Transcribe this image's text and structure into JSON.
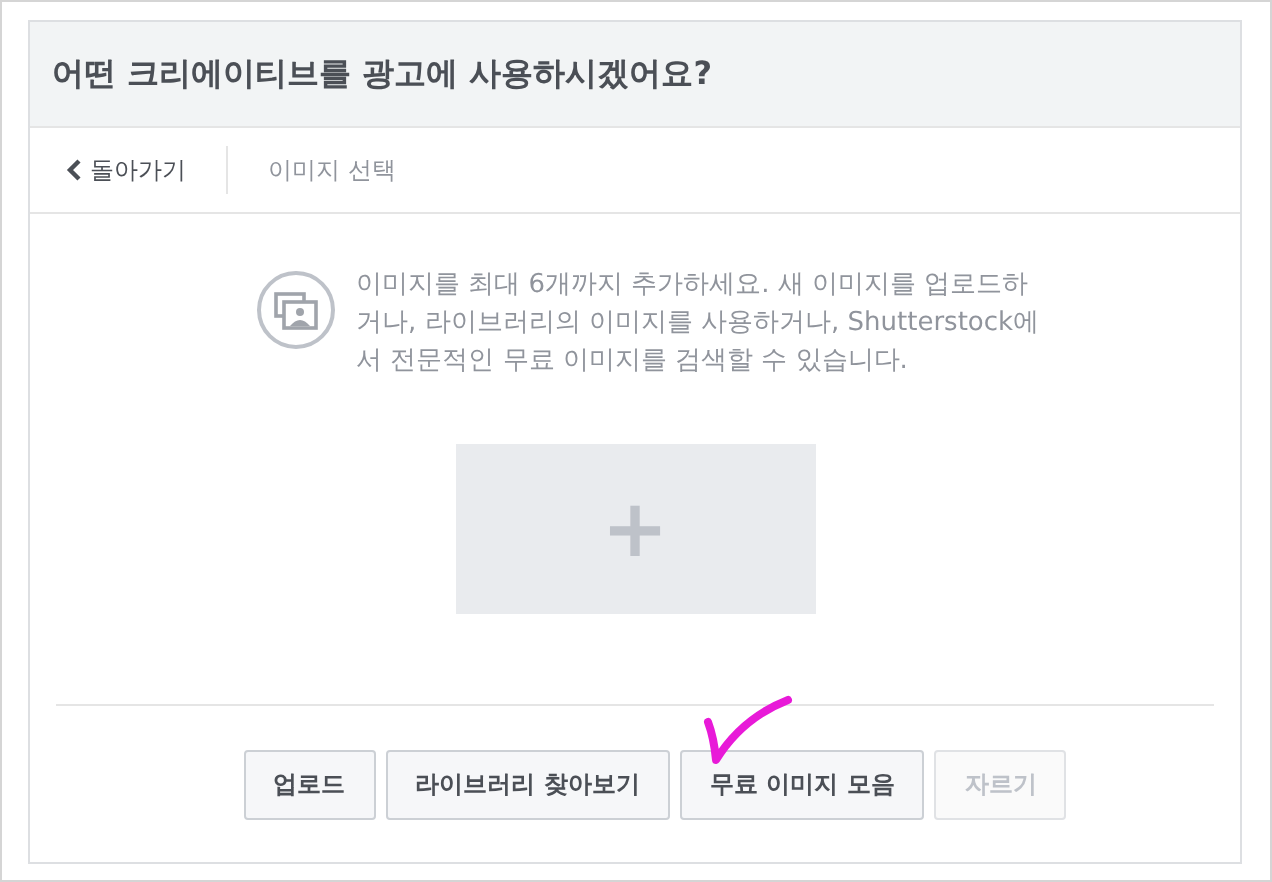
{
  "dialog": {
    "title": "어떤 크리에이티브를 광고에 사용하시겠어요?"
  },
  "nav": {
    "back": "돌아가기",
    "current": "이미지 선택"
  },
  "intro": "이미지를 최대 6개까지 추가하세요. 새 이미지를 업로드하거나, 라이브러리의 이미지를 사용하거나, Shutterstock에서 전문적인 무료 이미지를 검색할 수 있습니다.",
  "add_image": {
    "label": "+"
  },
  "buttons": [
    {
      "label": "업로드",
      "disabled": false
    },
    {
      "label": "라이브러리 찾아보기",
      "disabled": false
    },
    {
      "label": "무료 이미지 모음",
      "disabled": false
    },
    {
      "label": "자르기",
      "disabled": true
    }
  ]
}
